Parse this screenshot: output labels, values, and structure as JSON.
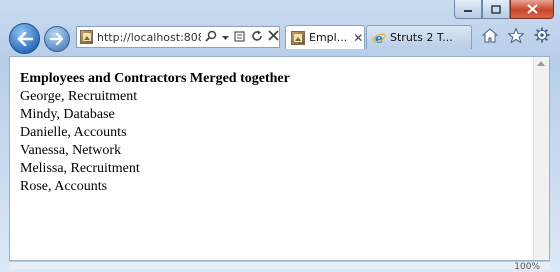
{
  "browser": {
    "address": {
      "url": "http://localhost:808"
    },
    "tabs": [
      {
        "label": "Empl..."
      },
      {
        "label": "Struts 2 T..."
      }
    ],
    "icons": {
      "back": "back-arrow-icon",
      "forward": "forward-arrow-icon",
      "search": "search-icon",
      "compat": "compatibility-view-icon",
      "refresh": "refresh-icon",
      "stop": "stop-icon",
      "home": "home-icon",
      "favorites": "star-icon",
      "tools": "gear-icon"
    },
    "zoom": "100%"
  },
  "page": {
    "heading": "Employees and Contractors Merged together",
    "items": [
      "George, Recruitment",
      "Mindy, Database",
      "Danielle, Accounts",
      "Vanessa, Network",
      "Melissa, Recruitment",
      "Rose, Accounts"
    ]
  }
}
